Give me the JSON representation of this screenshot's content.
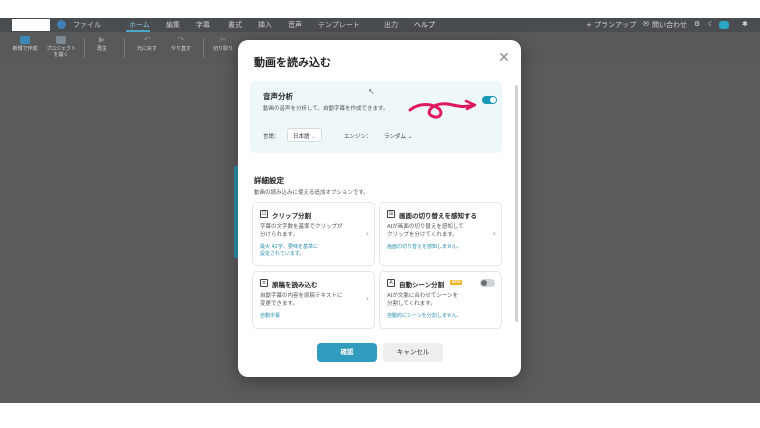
{
  "menubar": {
    "items": [
      {
        "label": "ファイル",
        "active": false
      },
      {
        "label": "ホーム",
        "active": true
      },
      {
        "label": "編集",
        "active": false
      },
      {
        "label": "字幕",
        "active": false
      },
      {
        "label": "書式",
        "active": false
      },
      {
        "label": "挿入",
        "active": false
      },
      {
        "label": "音声",
        "active": false
      },
      {
        "label": "テンプレート",
        "active": false
      },
      {
        "label": "出力",
        "active": false
      },
      {
        "label": "ヘルプ",
        "active": false
      }
    ],
    "upgrade_label": "+ プランアップ",
    "contact_label": "問い合わせ"
  },
  "toolbar": {
    "new_label": "新規で作成",
    "open_project_label": "プロジェクト\nを開く",
    "play_label": "再生",
    "undo_label": "元に戻す",
    "redo_label": "やり直す",
    "cut_label": "切り取り"
  },
  "dialog": {
    "title": "動画を読み込む",
    "audio_analysis": {
      "title": "音声分析",
      "description": "動画の音声を分析して、自動字幕を作成できます。",
      "enabled": true,
      "language_label": "言語：",
      "language_value": "日本語",
      "engine_label": "エンジン：",
      "engine_value": "ランダム ⌄"
    },
    "advanced": {
      "title": "詳細設定",
      "description": "動画の読み込みに使える追加オプションです。"
    },
    "cards": [
      {
        "title": "クリップ分割",
        "desc_line1": "字幕の文字数を基準でクリップが",
        "desc_line2": "分けられます。",
        "note_line1": "最大 42字、要味を基準に",
        "note_line2": "設定されています。"
      },
      {
        "title": "画面の切り替えを感知する",
        "desc_line1": "AIが画面の切り替えを感知して",
        "desc_line2": "クリップを分けてくれます。",
        "note_line1": "画面の切り替えを感知しません。"
      },
      {
        "title": "原稿を読み込む",
        "desc_line1": "自動字幕の内容を原稿テキストに",
        "desc_line2": "変更できます。",
        "note_line1": "自動字幕"
      },
      {
        "title": "自動シーン分割",
        "badge": "NEW",
        "enabled": false,
        "desc_line1": "AIが文脈に合わせてシーンを",
        "desc_line2": "分割してくれます。",
        "note_line1": "自動的にシーンを分割しません。"
      }
    ],
    "confirm_label": "確認",
    "cancel_label": "キャンセル"
  },
  "colors": {
    "accent": "#2f9bbd",
    "toggle_on": "#1e9ab7",
    "annotation": "#e0195f",
    "badge": "#f3b21a"
  },
  "icons": [
    "user-icon",
    "new-project-icon",
    "folder-icon",
    "play-icon",
    "undo-icon",
    "redo-icon",
    "scissors-icon",
    "close-icon",
    "cursor-icon",
    "chevron-right-icon",
    "help-icon",
    "settings-icon"
  ]
}
